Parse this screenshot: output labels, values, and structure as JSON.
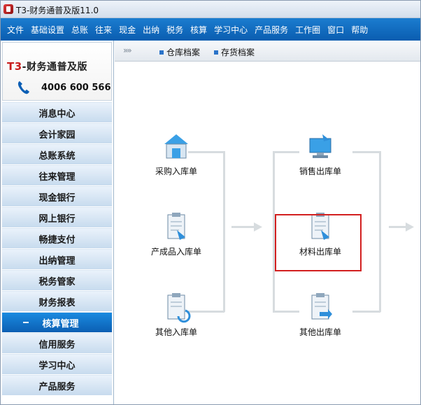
{
  "window": {
    "title": "T3-财务通普及版11.0"
  },
  "menu": [
    "文件",
    "基础设置",
    "总账",
    "往来",
    "现金",
    "出纳",
    "税务",
    "核算",
    "学习中心",
    "产品服务",
    "工作圈",
    "窗口",
    "帮助"
  ],
  "logo": {
    "brand_prefix": "T3",
    "brand_text": "-财务通普及版",
    "phone": "4006 600 566"
  },
  "nav": [
    {
      "label": "消息中心",
      "active": false
    },
    {
      "label": "会计家园",
      "active": false
    },
    {
      "label": "总账系统",
      "active": false
    },
    {
      "label": "往来管理",
      "active": false
    },
    {
      "label": "现金银行",
      "active": false
    },
    {
      "label": "网上银行",
      "active": false
    },
    {
      "label": "畅捷支付",
      "active": false
    },
    {
      "label": "出纳管理",
      "active": false
    },
    {
      "label": "税务管家",
      "active": false
    },
    {
      "label": "财务报表",
      "active": false
    },
    {
      "label": "核算管理",
      "active": true
    },
    {
      "label": "信用服务",
      "active": false
    },
    {
      "label": "学习中心",
      "active": false
    },
    {
      "label": "产品服务",
      "active": false
    }
  ],
  "toolbar": {
    "chevrons": "»»",
    "links": [
      "仓库档案",
      "存货档案"
    ]
  },
  "flow": {
    "inbound": [
      "采购入库单",
      "产成品入库单",
      "其他入库单"
    ],
    "outbound": [
      "销售出库单",
      "材料出库单",
      "其他出库单"
    ],
    "highlighted": "材料出库单"
  },
  "colors": {
    "menubar": "#0a5db0",
    "nav_active": "#0b5fb3",
    "highlight": "#d21f1f"
  }
}
